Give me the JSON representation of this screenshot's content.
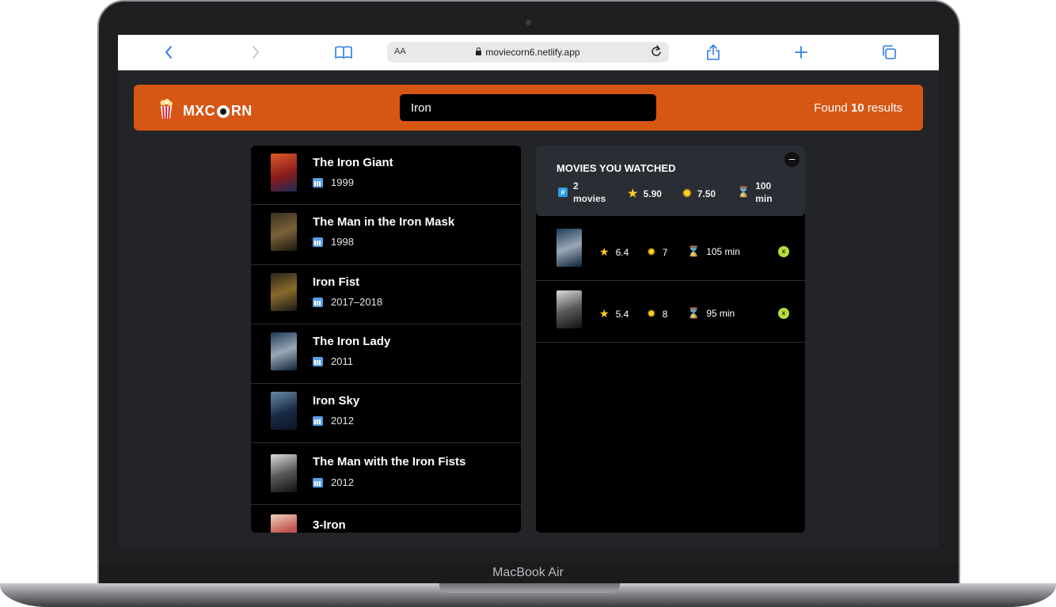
{
  "device": {
    "brand_label": "MacBook Air"
  },
  "browser": {
    "aa_label": "AA",
    "url": "moviecorn6.netlify.app"
  },
  "app": {
    "logo_text_left": "MXC",
    "logo_text_right": "RN",
    "search_value": "Iron",
    "found_prefix": "Found",
    "found_count": "10",
    "found_suffix": "results"
  },
  "movies": [
    {
      "title": "The Iron Giant",
      "year": "1999",
      "poster_color": "#c0392b"
    },
    {
      "title": "The Man in the Iron Mask",
      "year": "1998",
      "poster_color": "#5a4a2e"
    },
    {
      "title": "Iron Fist",
      "year": "2017–2018",
      "poster_color": "#6b5a2a"
    },
    {
      "title": "The Iron Lady",
      "year": "2011",
      "poster_color": "#2c4a6e"
    },
    {
      "title": "Iron Sky",
      "year": "2012",
      "poster_color": "#3a5a7a"
    },
    {
      "title": "The Man with the Iron Fists",
      "year": "2012",
      "poster_color": "#9a9a9a"
    },
    {
      "title": "3-Iron",
      "year": "",
      "poster_color": "#c88b7a"
    }
  ],
  "watched": {
    "title": "MOVIES YOU WATCHED",
    "close_label": "–",
    "count_value": "2",
    "count_unit": "movies",
    "avg_imdb": "5.90",
    "avg_user": "7.50",
    "avg_runtime_value": "100",
    "avg_runtime_unit": "min",
    "items": [
      {
        "imdb": "6.4",
        "user": "7",
        "runtime": "105 min",
        "remove_label": "x",
        "poster_color": "#2c4a6e"
      },
      {
        "imdb": "5.4",
        "user": "8",
        "runtime": "95 min",
        "remove_label": "x",
        "poster_color": "#9a9a9a"
      }
    ]
  },
  "icons": {
    "back": "chevron-left-icon",
    "forward": "chevron-right-icon",
    "bookmarks": "book-icon",
    "share": "share-icon",
    "new_tab": "plus-icon",
    "tabs": "tabs-icon",
    "popcorn": "popcorn-icon",
    "calendar": "calendar-icon",
    "star": "star-icon",
    "sun": "sun-icon",
    "hourglass": "hourglass-icon"
  },
  "colors": {
    "header_orange": "#d65613",
    "panel_black": "#000000",
    "summary_gray": "#2a2d33",
    "remove_green": "#b3e03a",
    "star_yellow": "#ffce1f"
  }
}
